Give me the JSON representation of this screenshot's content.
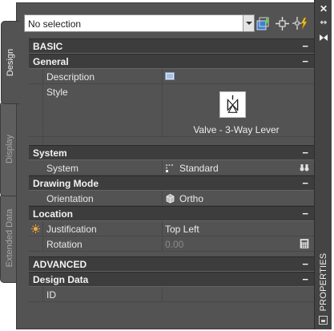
{
  "tabs": {
    "design": "Design",
    "display": "Display",
    "extended": "Extended Data"
  },
  "titlebar": {
    "title": "PROPERTIES",
    "close_icon": "close-icon",
    "autohide_icon": "autohide-icon",
    "options_icon": "options-icon"
  },
  "selection": {
    "value": "No selection"
  },
  "toolbar": {
    "add_icon": "add-selection-icon",
    "select_icon": "select-objects-icon",
    "quick_select_icon": "quick-select-icon"
  },
  "sections": {
    "basic": {
      "label": "BASIC",
      "toggle": "−"
    },
    "general": {
      "label": "General",
      "toggle": "−"
    },
    "system": {
      "label": "System",
      "toggle": "−"
    },
    "drawing_mode": {
      "label": "Drawing Mode",
      "toggle": "−"
    },
    "location": {
      "label": "Location",
      "toggle": "−"
    },
    "advanced": {
      "label": "ADVANCED",
      "toggle": "−"
    },
    "design_data": {
      "label": "Design Data",
      "toggle": "−"
    }
  },
  "props": {
    "description": {
      "name": "Description",
      "value": ""
    },
    "style": {
      "name": "Style",
      "value": "Valve - 3-Way Lever"
    },
    "system": {
      "name": "System",
      "value": "Standard"
    },
    "orientation": {
      "name": "Orientation",
      "value": "Ortho"
    },
    "justification": {
      "name": "Justification",
      "value": "Top Left"
    },
    "rotation": {
      "name": "Rotation",
      "value": "0.00"
    },
    "id": {
      "name": "ID",
      "value": ""
    }
  }
}
